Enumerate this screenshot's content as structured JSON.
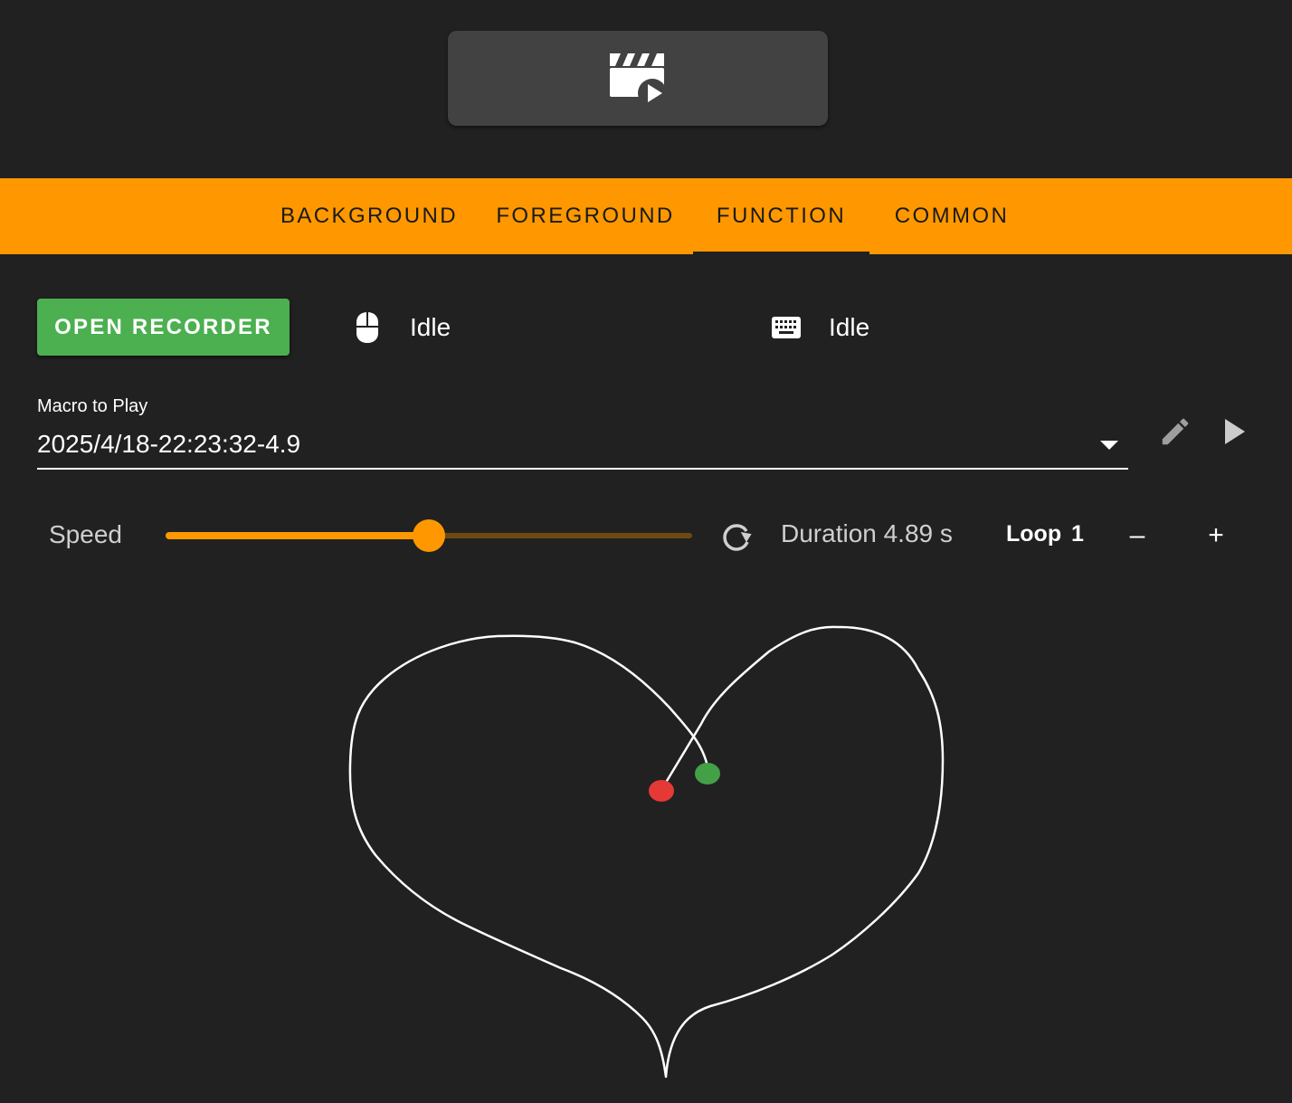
{
  "header": {
    "mode_icon": "video-clip-play-icon"
  },
  "tabs": [
    {
      "label": "BACKGROUND",
      "active": false
    },
    {
      "label": "FOREGROUND",
      "active": false
    },
    {
      "label": "FUNCTION",
      "active": true
    },
    {
      "label": "COMMON",
      "active": false
    }
  ],
  "recorder": {
    "button_label": "OPEN RECORDER",
    "mouse_icon": "mouse-icon",
    "mouse_status": "Idle",
    "keyboard_icon": "keyboard-icon",
    "keyboard_status": "Idle"
  },
  "macro": {
    "label": "Macro to Play",
    "selected": "2025/4/18-22:23:32-4.9",
    "edit_icon": "pencil-icon",
    "play_icon": "play-icon"
  },
  "playback": {
    "speed_label": "Speed",
    "speed_fraction": 0.5,
    "reset_icon": "refresh-icon",
    "duration_text": "Duration 4.89 s",
    "loop_label": "Loop",
    "loop_value": "1",
    "decrement_label": "–",
    "increment_label": "+"
  },
  "path_preview": {
    "shape": "heart",
    "start_color": "#43a047",
    "end_color": "#e53935",
    "line_color": "#ffffff"
  },
  "colors": {
    "background": "#212121",
    "accent": "#ff9800",
    "record_button": "#4caf50",
    "card": "#424242"
  }
}
